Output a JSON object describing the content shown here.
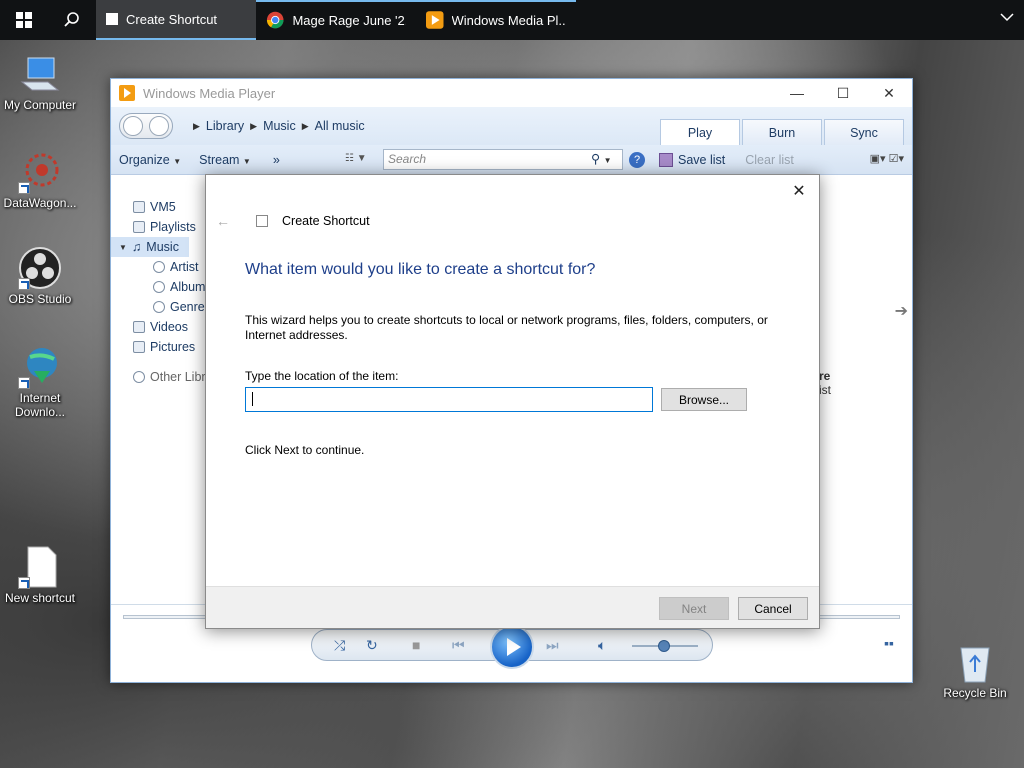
{
  "taskbar": {
    "items": [
      {
        "label": "Create Shortcut"
      },
      {
        "label": "Mage Rage June '2..."
      },
      {
        "label": "Windows Media Pl..."
      }
    ]
  },
  "desktop": {
    "icons": [
      {
        "label": "My Computer"
      },
      {
        "label": "DataWagon..."
      },
      {
        "label": "OBS Studio"
      },
      {
        "label": "Internet Downlo..."
      },
      {
        "label": "New shortcut"
      },
      {
        "label": "Recycle Bin"
      }
    ]
  },
  "wmp": {
    "title": "Windows Media Player",
    "breadcrumbs": [
      "Library",
      "Music",
      "All music"
    ],
    "tabs": [
      "Play",
      "Burn",
      "Sync"
    ],
    "toolbar": {
      "organize": "Organize",
      "stream": "Stream",
      "more": "»",
      "search_placeholder": "Search",
      "save_list": "Save list",
      "clear_list": "Clear list"
    },
    "sidebar": [
      {
        "label": "VM5"
      },
      {
        "label": "Playlists"
      },
      {
        "label": "Music"
      },
      {
        "label": "Artist"
      },
      {
        "label": "Album"
      },
      {
        "label": "Genre"
      },
      {
        "label": "Videos"
      },
      {
        "label": "Pictures"
      },
      {
        "label": "Other Libr"
      }
    ],
    "right_text": [
      "re",
      "ist"
    ]
  },
  "dialog": {
    "title": "Create Shortcut",
    "heading": "What item would you like to create a shortcut for?",
    "description": "This wizard helps you to create shortcuts to local or network programs, files, folders, computers, or Internet addresses.",
    "location_label": "Type the location of the item:",
    "location_value": "",
    "browse": "Browse...",
    "continue_text": "Click Next to continue.",
    "next": "Next",
    "cancel": "Cancel"
  }
}
